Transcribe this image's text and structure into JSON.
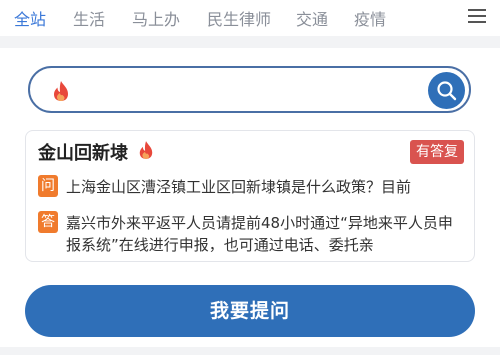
{
  "nav": {
    "tabs": [
      "全站",
      "生活",
      "马上办",
      "民生律师",
      "交通",
      "疫情"
    ],
    "active_tab": "全站"
  },
  "search": {
    "value": "",
    "placeholder": ""
  },
  "card": {
    "title": "金山回新埭",
    "badge": "有答复",
    "question_icon": "问",
    "question": "上海金山区漕泾镇工业区回新埭镇是什么政策？目前",
    "answer_icon": "答",
    "answer": "嘉兴市外来平返平人员请提前48小时通过“异地来平人员申报系统”在线进行申报，也可通过电话、委托亲"
  },
  "ask_button": {
    "label": "我要提问"
  },
  "colors": {
    "accent": "#2f6fb8",
    "active_tab": "#3b78d8",
    "badge": "#d9534f",
    "qa_icon": "#f07b2d",
    "flame": "#e8483b"
  },
  "icons": [
    "flame-icon",
    "search-icon",
    "menu-icon"
  ]
}
